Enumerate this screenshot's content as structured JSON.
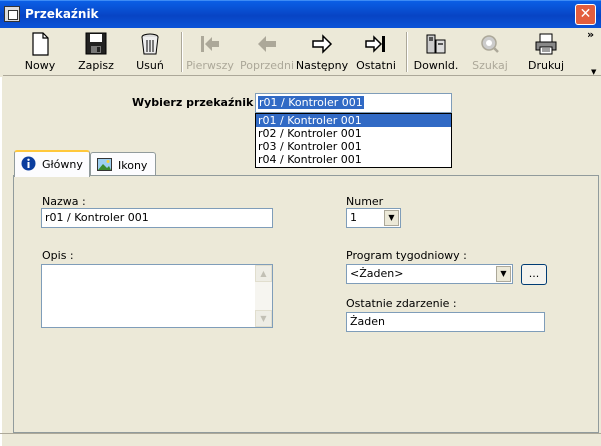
{
  "window": {
    "title": "Przekaźnik",
    "close_symbol": "✕"
  },
  "toolbar": {
    "buttons": [
      {
        "label": "Nowy",
        "icon": "new-document-icon",
        "enabled": true
      },
      {
        "label": "Zapisz",
        "icon": "save-disk-icon",
        "enabled": true
      },
      {
        "label": "Usuń",
        "icon": "trash-can-icon",
        "enabled": true
      },
      {
        "label": "Pierwszy",
        "icon": "first-arrow-icon",
        "enabled": false
      },
      {
        "label": "Poprzedni",
        "icon": "previous-arrow-icon",
        "enabled": false
      },
      {
        "label": "Następny",
        "icon": "next-arrow-icon",
        "enabled": true
      },
      {
        "label": "Ostatni",
        "icon": "last-arrow-icon",
        "enabled": true
      },
      {
        "label": "Downld.",
        "icon": "download-device-icon",
        "enabled": true
      },
      {
        "label": "Szukaj",
        "icon": "search-icon",
        "enabled": false
      },
      {
        "label": "Drukuj",
        "icon": "printer-icon",
        "enabled": true
      }
    ],
    "overflow_symbol": "»",
    "overflow_arrow": "▼"
  },
  "selector": {
    "label": "Wybierz przekaźnik :",
    "value": "r01 / Kontroler 001",
    "options": [
      "r01 / Kontroler 001",
      "r02 / Kontroler 001",
      "r03 / Kontroler 001",
      "r04 / Kontroler 001"
    ],
    "selected_index": 0
  },
  "tabs": [
    {
      "label": "Główny",
      "icon": "info-icon",
      "active": true
    },
    {
      "label": "Ikony",
      "icon": "picture-icon",
      "active": false
    }
  ],
  "form": {
    "name_label": "Nazwa :",
    "name_value": "r01 / Kontroler 001",
    "desc_label": "Opis :",
    "desc_value": "",
    "number_label": "Numer",
    "number_value": "1",
    "program_label": "Program tygodniowy :",
    "program_value": "<Żaden>",
    "program_button": "...",
    "last_event_label": "Ostatnie zdarzenie :",
    "last_event_value": "Żaden"
  },
  "colors": {
    "title_bar": "#0A5FE6",
    "selection": "#316AC5",
    "close_button": "#E35E3E",
    "window_bg": "#ECE9D8"
  }
}
